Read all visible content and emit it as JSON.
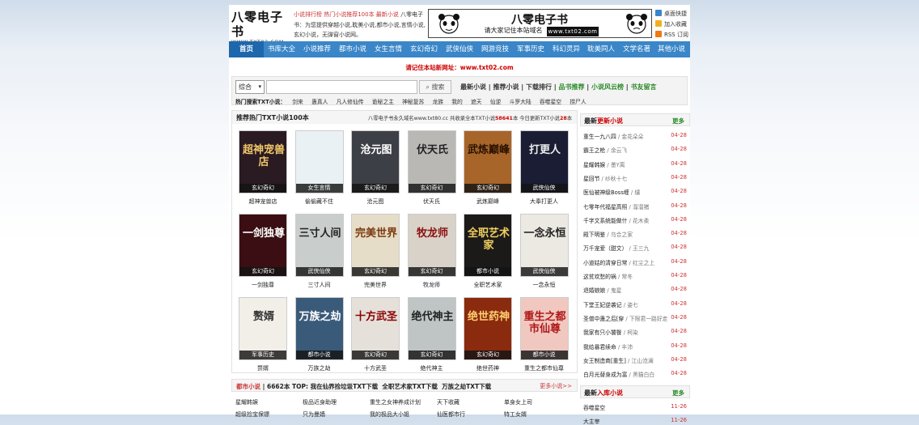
{
  "header": {
    "logo_cn": "八零电子书",
    "logo_url": "WWW.TXT02.COM",
    "intro_hot": "小说排行榜 热门小说推荐100本 最新小说",
    "intro_text": "八零电子书：为您提供穿越小说,耽美小说,都市小说,言情小说,玄幻小说，无弹窗小说网。",
    "banner_title": "八零电子书",
    "banner_sub": "请大家记住本站域名",
    "banner_url": "www.txt02.com",
    "quick": [
      "桌面快捷",
      "加入收藏",
      "RSS 订阅"
    ]
  },
  "nav": [
    "首页",
    "书库大全",
    "小说推荐",
    "都市小说",
    "女生言情",
    "玄幻奇幻",
    "武侠仙侠",
    "网游竞技",
    "军事历史",
    "科幻灵异",
    "耽美同人",
    "文学名著",
    "其他小说"
  ],
  "notice": "请记住本站新网址：www.txt02.com",
  "search": {
    "select_value": "综合",
    "button": "搜索",
    "links": [
      "最新小说",
      "推荐小说",
      "下载排行",
      "品书推荐",
      "小说风云榜",
      "书友留言"
    ],
    "hot_label": "热门搜索TXT小说：",
    "hot": [
      "剑来",
      "蛊真人",
      "凡人修仙传",
      "诡秘之主",
      "神秘复苏",
      "龙族",
      "我的",
      "遮天",
      "仙逆",
      "斗罗大陆",
      "吞噬星空",
      "捞尸人"
    ]
  },
  "recommend": {
    "title": "推荐热门TXT小说100本",
    "info_prefix": "八零电子书永久域名www.txt80.cc 共收录全本TXT小说",
    "info_count": "58641",
    "info_mid": "本 今日更新TXT小说",
    "info_today": "28",
    "info_suffix": "本",
    "books": [
      {
        "name": "超神宠兽店",
        "cat": "玄幻奇幻",
        "cover_text": "超神宠兽店",
        "bg": "#2a1a22",
        "fg": "#f0c86a"
      },
      {
        "name": "偷偷藏不住",
        "cat": "女生言情",
        "cover_text": "",
        "bg": "#eaf1f4",
        "fg": "#6a8ca0"
      },
      {
        "name": "沧元图",
        "cat": "玄幻奇幻",
        "cover_text": "沧元图",
        "bg": "#3d3f46",
        "fg": "#ffffff"
      },
      {
        "name": "伏天氏",
        "cat": "玄幻奇幻",
        "cover_text": "伏天氏",
        "bg": "#b9b8b5",
        "fg": "#222222"
      },
      {
        "name": "武炼巅峰",
        "cat": "玄幻奇幻",
        "cover_text": "武炼巅峰",
        "bg": "#a7652a",
        "fg": "#2a1200"
      },
      {
        "name": "大奉打更人",
        "cat": "武侠仙侠",
        "cover_text": "打更人",
        "bg": "#1b1d34",
        "fg": "#eeeeee"
      },
      {
        "name": "一剑独尊",
        "cat": "玄幻奇幻",
        "cover_text": "一剑独尊",
        "bg": "#3a0e12",
        "fg": "#ffffff"
      },
      {
        "name": "三寸人间",
        "cat": "武侠仙侠",
        "cover_text": "三寸人间",
        "bg": "#c9cdcb",
        "fg": "#222222"
      },
      {
        "name": "完美世界",
        "cat": "玄幻奇幻",
        "cover_text": "完美世界",
        "bg": "#e6ddc8",
        "fg": "#7a3a10"
      },
      {
        "name": "牧龙师",
        "cat": "玄幻奇幻",
        "cover_text": "牧龙师",
        "bg": "#d9d2c8",
        "fg": "#8a1010"
      },
      {
        "name": "全职艺术家",
        "cat": "都市小说",
        "cover_text": "全职艺术家",
        "bg": "#1c1a18",
        "fg": "#f0d060"
      },
      {
        "name": "一念永恒",
        "cat": "武侠仙侠",
        "cover_text": "一念永恒",
        "bg": "#ece9e2",
        "fg": "#222222"
      },
      {
        "name": "赘婿",
        "cat": "军事历史",
        "cover_text": "赘婿",
        "bg": "#f2efe8",
        "fg": "#333333"
      },
      {
        "name": "万族之劫",
        "cat": "都市小说",
        "cover_text": "万族之劫",
        "bg": "#3a5a7a",
        "fg": "#ffffff"
      },
      {
        "name": "十方武圣",
        "cat": "玄幻奇幻",
        "cover_text": "十方武圣",
        "bg": "#e5e1da",
        "fg": "#8a0000"
      },
      {
        "name": "绝代神主",
        "cat": "玄幻奇幻",
        "cover_text": "绝代神主",
        "bg": "#bfc4c4",
        "fg": "#222222"
      },
      {
        "name": "绝世药神",
        "cat": "玄幻奇幻",
        "cover_text": "绝世药神",
        "bg": "#8a2a0e",
        "fg": "#ffd070"
      },
      {
        "name": "重生之都市仙尊",
        "cat": "都市小说",
        "cover_text": "重生之都市仙尊",
        "bg": "#f0c8c0",
        "fg": "#b01818"
      }
    ]
  },
  "urban": {
    "label": "都市小说",
    "count_text": "| 6662本 TOP:",
    "top": [
      "我在仙界捡垃圾TXT下载",
      "全职艺术家TXT下载",
      "万族之劫TXT下载"
    ],
    "more": "更多小说>>",
    "row1": [
      "星耀韩娱",
      "极品近身助理",
      "重生之女神养成计划",
      "天下收藏",
      "单身女上司"
    ],
    "row2": [
      "超级捡宝保镖",
      "只为曼嫱",
      "我的极品大小姐",
      "仙医都市行",
      "特工女婿"
    ]
  },
  "sidebar": {
    "latest_title_a": "最新",
    "latest_title_b": "更新小说",
    "more": "更多",
    "latest": [
      {
        "name": "重生一九八四",
        "author": "金花朵朵",
        "date": "04-28"
      },
      {
        "name": "霸王之枪",
        "author": "余云飞",
        "date": "04-28"
      },
      {
        "name": "星耀韩娱",
        "author": "墨Y离",
        "date": "04-28"
      },
      {
        "name": "星回节",
        "author": "纱秋十七",
        "date": "04-28"
      },
      {
        "name": "医仙被神级Boss缠",
        "author": "缱",
        "date": "04-28"
      },
      {
        "name": "七零年代福星高照",
        "author": "溜溜猪",
        "date": "04-28"
      },
      {
        "name": "千字文系统能做什",
        "author": "花木柔",
        "date": "04-28"
      },
      {
        "name": "殿下明鉴",
        "author": "乌合之家",
        "date": "04-28"
      },
      {
        "name": "万千宠爱（甜文）",
        "author": "王三九",
        "date": "04-28"
      },
      {
        "name": "小道姑的清穿日常",
        "author": "红尘之上",
        "date": "04-28"
      },
      {
        "name": "这贫欢愁的祸",
        "author": "常冬",
        "date": "04-28"
      },
      {
        "name": "退婚娘娘",
        "author": "鬼星",
        "date": "04-28"
      },
      {
        "name": "下堂王妃逆袭记",
        "author": "姿七",
        "date": "04-28"
      },
      {
        "name": "圣僧中蛊之后[穿",
        "author": "下限君一路好走",
        "date": "04-28"
      },
      {
        "name": "我家有只小饕餮",
        "author": "柯染",
        "date": "04-28"
      },
      {
        "name": "我给暴君续命",
        "author": "丰沛",
        "date": "04-28"
      },
      {
        "name": "女王制造商[重生]",
        "author": "江山沧澜",
        "date": "04-28"
      },
      {
        "name": "白月光替身成为富",
        "author": "黑猫白白",
        "date": "04-28"
      }
    ],
    "latest2_title_a": "最新",
    "latest2_title_b": "入库小说",
    "latest2": [
      {
        "name": "吞噬星空",
        "date": "11-26"
      },
      {
        "name": "大主宰",
        "date": "11-26"
      }
    ]
  }
}
